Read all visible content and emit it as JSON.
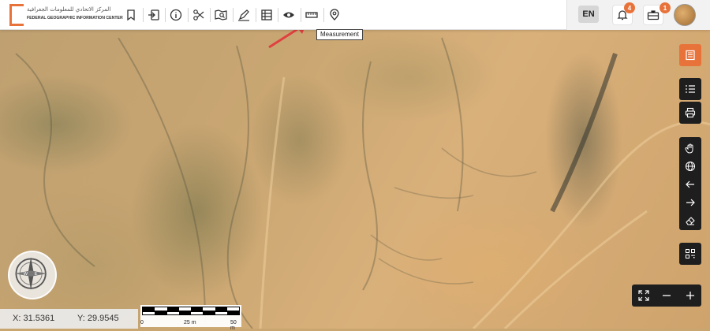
{
  "header": {
    "logo_arabic": "المركز الاتحادي للمعلومات الجغرافية",
    "logo_english": "FEDERAL GEOGRAPHIC INFORMATION CENTER",
    "tools": [
      {
        "name": "bookmark-icon"
      },
      {
        "name": "login-icon"
      },
      {
        "name": "info-icon"
      },
      {
        "name": "scissors-icon"
      },
      {
        "name": "map-search-icon"
      },
      {
        "name": "draw-icon"
      },
      {
        "name": "table-icon"
      },
      {
        "name": "eye-icon"
      },
      {
        "name": "ruler-icon"
      },
      {
        "name": "location-pin-icon"
      }
    ],
    "tooltip": "Measurement",
    "language_button": "EN",
    "notifications_count": "4",
    "briefcase_count": "1"
  },
  "coordinates": {
    "x_label": "X: 31.5361",
    "y_label": "Y: 29.9545"
  },
  "scale_bar": {
    "labels": [
      "0",
      "25 m",
      "50 m"
    ]
  },
  "colors": {
    "accent": "#e8733a",
    "control_dark": "#1e1e1e",
    "arrow": "#e04040"
  }
}
